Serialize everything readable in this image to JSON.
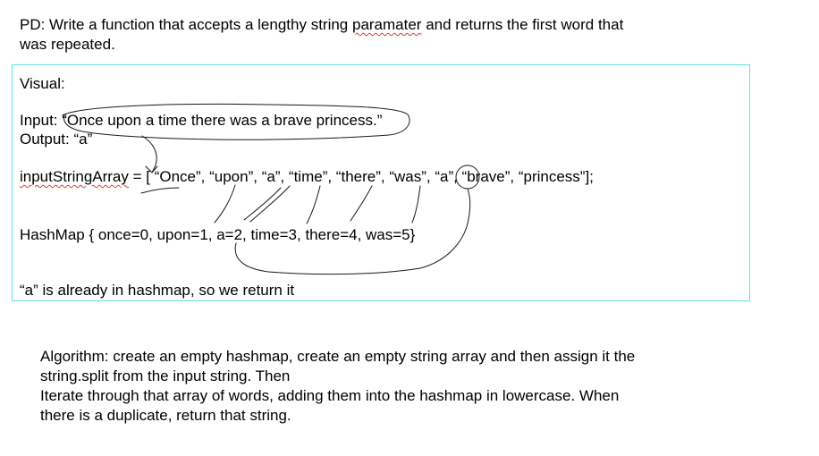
{
  "problem": {
    "line1_prefix": "PD: Write a function that accepts a lengthy string ",
    "line1_misspelled": "paramater",
    "line1_suffix": " and returns the first word that",
    "line2": "was repeated."
  },
  "visual": {
    "heading": "Visual:",
    "input_line": "Input: “Once upon a time there was a brave princess.”",
    "output_line": "Output: “a”",
    "array_name": "inputStringArray",
    "array_rest": " = [ “Once”, “upon”, “a”, “time”, “there”, “was”, “a”, “brave”, “princess”];",
    "hashmap_line": "HashMap  { once=0, upon=1, a=2, time=3, there=4, was=5}",
    "conclusion": "“a” is already in hashmap, so we return it"
  },
  "algorithm": {
    "line1": "Algorithm: create an empty hashmap, create an empty string array and then assign it the",
    "line2": "string.split from the input string. Then",
    "line3": "Iterate through that array of words, adding them into the hashmap in lowercase. When",
    "line4": "there is a duplicate, return that string."
  },
  "colors": {
    "box_border": "#5fe0e6",
    "spellcheck": "#d04040",
    "ink": "#1a1a1a"
  }
}
